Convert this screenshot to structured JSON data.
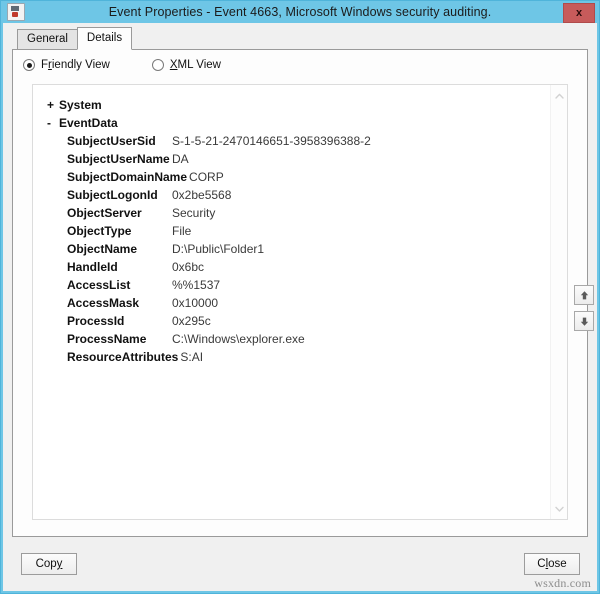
{
  "window": {
    "title": "Event Properties - Event 4663, Microsoft Windows security auditing.",
    "icon": "event-log-icon",
    "close_label": "x"
  },
  "tabs": [
    {
      "label": "General",
      "active": false
    },
    {
      "label": "Details",
      "active": true
    }
  ],
  "view_options": {
    "friendly": {
      "label_pre": "F",
      "label_acc": "r",
      "label_post": "iendly View",
      "checked": true
    },
    "xml": {
      "label_pre": "",
      "label_acc": "X",
      "label_post": "ML View",
      "checked": false
    }
  },
  "tree": {
    "nodes": [
      {
        "marker": "+",
        "name": "System",
        "expanded": false
      },
      {
        "marker": "-",
        "name": "EventData",
        "expanded": true
      }
    ]
  },
  "event_data": [
    {
      "key": "SubjectUserSid",
      "value": "S-1-5-21-2470146651-3958396388-2"
    },
    {
      "key": "SubjectUserName",
      "value": "DA"
    },
    {
      "key": "SubjectDomainName",
      "value": "CORP"
    },
    {
      "key": "SubjectLogonId",
      "value": "0x2be5568"
    },
    {
      "key": "ObjectServer",
      "value": "Security"
    },
    {
      "key": "ObjectType",
      "value": "File"
    },
    {
      "key": "ObjectName",
      "value": "D:\\Public\\Folder1"
    },
    {
      "key": "HandleId",
      "value": "0x6bc"
    },
    {
      "key": "AccessList",
      "value": "%%1537"
    },
    {
      "key": "AccessMask",
      "value": "0x10000"
    },
    {
      "key": "ProcessId",
      "value": "0x295c"
    },
    {
      "key": "ProcessName",
      "value": "C:\\Windows\\explorer.exe"
    },
    {
      "key": "ResourceAttributes",
      "value": "S:AI"
    }
  ],
  "scrollbar": {
    "up_arrow": "chevron-up-icon",
    "down_arrow": "chevron-down-icon"
  },
  "side_nav": {
    "previous": "arrow-up-icon",
    "next": "arrow-down-icon"
  },
  "buttons": {
    "copy": {
      "pre": "Cop",
      "acc": "y",
      "post": ""
    },
    "close": {
      "pre": "C",
      "acc": "l",
      "post": "ose"
    }
  },
  "watermark": "wsxdn.com",
  "colors": {
    "titlebar": "#6ec6e6",
    "close_button": "#c75b5b",
    "dialog_bg": "#f0f0f0",
    "panel_bg": "#ffffff"
  }
}
